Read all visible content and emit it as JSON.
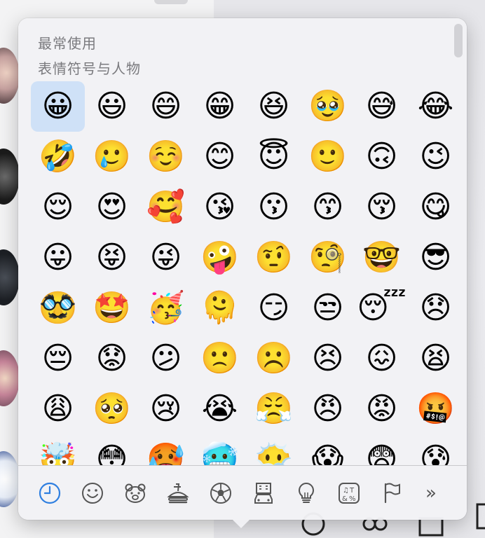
{
  "sections": {
    "frequently_used": "最常使用",
    "smileys_people": "表情符号与人物"
  },
  "emoji_rows": [
    [
      "😀",
      "😃",
      "😄",
      "😁",
      "😆",
      "🥹",
      "😅",
      "😂"
    ],
    [
      "🤣",
      "🥲",
      "☺️",
      "😊",
      "😇",
      "🙂",
      "🙃",
      "😉"
    ],
    [
      "😌",
      "😍",
      "🥰",
      "😘",
      "😗",
      "😙",
      "😚",
      "😋"
    ],
    [
      "😛",
      "😝",
      "😜",
      "🤪",
      "🤨",
      "🧐",
      "🤓",
      "😎"
    ],
    [
      "🥸",
      "🤩",
      "🥳",
      "🫠",
      "😏",
      "😒",
      "😴",
      "😞"
    ],
    [
      "😔",
      "😟",
      "😕",
      "🙁",
      "☹️",
      "😣",
      "😖",
      "😫"
    ],
    [
      "😩",
      "🥺",
      "😢",
      "😭",
      "😤",
      "😠",
      "😡",
      "🤬"
    ],
    [
      "🤯",
      "😳",
      "🥵",
      "🥶",
      "😶‍🌫️",
      "😱",
      "😨",
      "😰"
    ]
  ],
  "selected_emoji": "😀",
  "category_tabs": [
    {
      "id": "recent",
      "icon": "clock-icon",
      "active": true
    },
    {
      "id": "smileys",
      "icon": "smiley-icon",
      "active": false
    },
    {
      "id": "animals",
      "icon": "bear-icon",
      "active": false
    },
    {
      "id": "food",
      "icon": "burger-drink-icon",
      "active": false
    },
    {
      "id": "activity",
      "icon": "soccer-ball-icon",
      "active": false
    },
    {
      "id": "travel",
      "icon": "car-building-icon",
      "active": false
    },
    {
      "id": "objects",
      "icon": "lightbulb-icon",
      "active": false
    },
    {
      "id": "symbols",
      "icon": "symbols-icon",
      "active": false
    },
    {
      "id": "flags",
      "icon": "flag-icon",
      "active": false
    }
  ],
  "more_label": "»",
  "colors": {
    "accent": "#2f7fe0",
    "selection": "#cfe1f7",
    "section_text": "#7a7a7e",
    "icon_gray": "#555555"
  }
}
